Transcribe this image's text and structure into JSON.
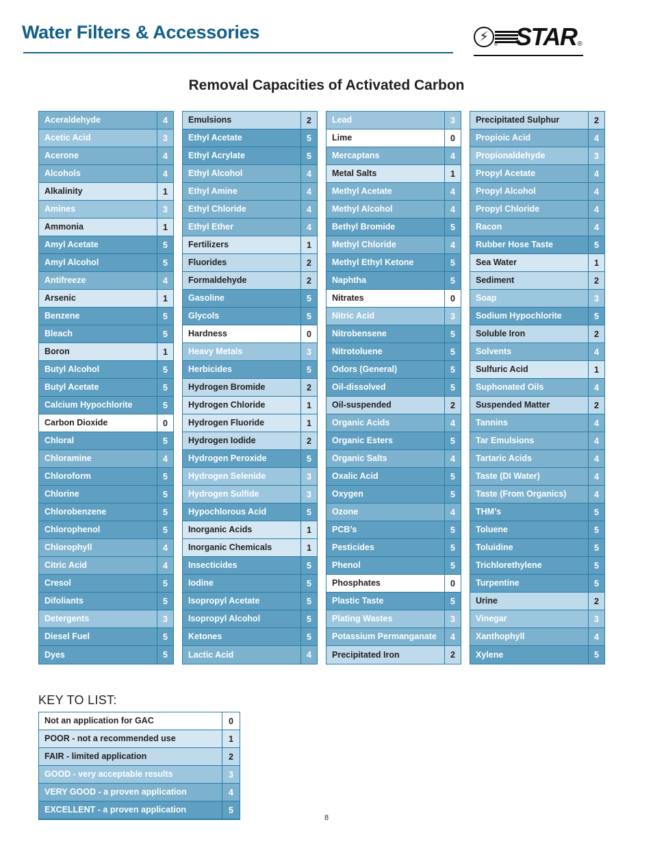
{
  "header": {
    "title": "Water Filters & Accessories",
    "logo": {
      "wordmark": "STAR",
      "registered": "®",
      "mark_glyph": "⚡"
    }
  },
  "section": {
    "title": "Removal Capacities of Activated Carbon"
  },
  "colors": {
    "brand_blue": "#115f88",
    "table_border": "#2a7ba6",
    "scale_0": "#ffffff",
    "scale_1": "#d4e7f2",
    "scale_2": "#bfdaea",
    "scale_3": "#9cc6de",
    "scale_4": "#7db2ce",
    "scale_5": "#5fa0c2"
  },
  "columns": [
    {
      "rows": [
        {
          "name": "Aceraldehyde",
          "value": "4"
        },
        {
          "name": "Acetic Acid",
          "value": "3"
        },
        {
          "name": "Acerone",
          "value": "4"
        },
        {
          "name": "Alcohols",
          "value": "4"
        },
        {
          "name": "Alkalinity",
          "value": "1"
        },
        {
          "name": "Amines",
          "value": "3"
        },
        {
          "name": "Ammonia",
          "value": "1"
        },
        {
          "name": "Amyl Acetate",
          "value": "5"
        },
        {
          "name": "Amyl Alcohol",
          "value": "5"
        },
        {
          "name": "Antifreeze",
          "value": "4"
        },
        {
          "name": "Arsenic",
          "value": "1"
        },
        {
          "name": "Benzene",
          "value": "5"
        },
        {
          "name": "Bleach",
          "value": "5"
        },
        {
          "name": "Boron",
          "value": "1"
        },
        {
          "name": "Butyl Alcohol",
          "value": "5"
        },
        {
          "name": "Butyl Acetate",
          "value": "5"
        },
        {
          "name": "Calcium Hypochlorite",
          "value": "5"
        },
        {
          "name": "Carbon Dioxide",
          "value": "0"
        },
        {
          "name": "Chloral",
          "value": "5"
        },
        {
          "name": "Chloramine",
          "value": "4"
        },
        {
          "name": "Chloroform",
          "value": "5"
        },
        {
          "name": "Chlorine",
          "value": "5"
        },
        {
          "name": "Chlorobenzene",
          "value": "5"
        },
        {
          "name": "Chlorophenol",
          "value": "5"
        },
        {
          "name": "Chlorophyll",
          "value": "4"
        },
        {
          "name": "Citric Acid",
          "value": "4"
        },
        {
          "name": "Cresol",
          "value": "5"
        },
        {
          "name": "Difoliants",
          "value": "5"
        },
        {
          "name": "Detergents",
          "value": "3"
        },
        {
          "name": "Diesel Fuel",
          "value": "5"
        },
        {
          "name": "Dyes",
          "value": "5"
        }
      ]
    },
    {
      "rows": [
        {
          "name": "Emulsions",
          "value": "2"
        },
        {
          "name": "Ethyl Acetate",
          "value": "5"
        },
        {
          "name": "Ethyl Acrylate",
          "value": "5"
        },
        {
          "name": "Ethyl Alcohol",
          "value": "4"
        },
        {
          "name": "Ethyl Amine",
          "value": "4"
        },
        {
          "name": "Ethyl Chloride",
          "value": "4"
        },
        {
          "name": "Ethyl Ether",
          "value": "4"
        },
        {
          "name": "Fertilizers",
          "value": "1"
        },
        {
          "name": "Fluorides",
          "value": "2"
        },
        {
          "name": "Formaldehyde",
          "value": "2"
        },
        {
          "name": "Gasoline",
          "value": "5"
        },
        {
          "name": "Glycols",
          "value": "5"
        },
        {
          "name": "Hardness",
          "value": "0"
        },
        {
          "name": "Heavy Metals",
          "value": "3"
        },
        {
          "name": "Herbicides",
          "value": "5"
        },
        {
          "name": "Hydrogen Bromide",
          "value": "2"
        },
        {
          "name": "Hydrogen Chloride",
          "value": "1"
        },
        {
          "name": "Hydrogen Fluoride",
          "value": "1"
        },
        {
          "name": "Hydrogen Iodide",
          "value": "2"
        },
        {
          "name": "Hydrogen Peroxide",
          "value": "5"
        },
        {
          "name": "Hydrogen Selenide",
          "value": "3"
        },
        {
          "name": "Hydrogen Sulfide",
          "value": "3"
        },
        {
          "name": "Hypochlorous Acid",
          "value": "5"
        },
        {
          "name": "Inorganic Acids",
          "value": "1"
        },
        {
          "name": "Inorganic Chemicals",
          "value": "1"
        },
        {
          "name": "Insecticides",
          "value": "5"
        },
        {
          "name": "Iodine",
          "value": "5"
        },
        {
          "name": "Isopropyl Acetate",
          "value": "5"
        },
        {
          "name": "Isopropyl Alcohol",
          "value": "5"
        },
        {
          "name": "Ketones",
          "value": "5"
        },
        {
          "name": "Lactic Acid",
          "value": "4"
        }
      ]
    },
    {
      "rows": [
        {
          "name": "Lead",
          "value": "3"
        },
        {
          "name": "Lime",
          "value": "0"
        },
        {
          "name": "Mercaptans",
          "value": "4"
        },
        {
          "name": "Metal Salts",
          "value": "1"
        },
        {
          "name": "Methyl Acetate",
          "value": "4"
        },
        {
          "name": "Methyl Alcohol",
          "value": "4"
        },
        {
          "name": "Bethyl Bromide",
          "value": "5"
        },
        {
          "name": "Methyl Chloride",
          "value": "4"
        },
        {
          "name": "Methyl Ethyl Ketone",
          "value": "5"
        },
        {
          "name": "Naphtha",
          "value": "5"
        },
        {
          "name": "Nitrates",
          "value": "0"
        },
        {
          "name": "Nitric Acid",
          "value": "3"
        },
        {
          "name": "Nitrobensene",
          "value": "5"
        },
        {
          "name": "Nitrotoluene",
          "value": "5"
        },
        {
          "name": "Odors (General)",
          "value": "5"
        },
        {
          "name": "Oil-dissolved",
          "value": "5"
        },
        {
          "name": "Oil-suspended",
          "value": "2"
        },
        {
          "name": "Organic Acids",
          "value": "4"
        },
        {
          "name": "Organic Esters",
          "value": "5"
        },
        {
          "name": "Organic Salts",
          "value": "4"
        },
        {
          "name": "Oxalic Acid",
          "value": "5"
        },
        {
          "name": "Oxygen",
          "value": "5"
        },
        {
          "name": "Ozone",
          "value": "4"
        },
        {
          "name": "PCB’s",
          "value": "5"
        },
        {
          "name": "Pesticides",
          "value": "5"
        },
        {
          "name": "Phenol",
          "value": "5"
        },
        {
          "name": "Phosphates",
          "value": "0"
        },
        {
          "name": "Plastic Taste",
          "value": "5"
        },
        {
          "name": "Plating Wastes",
          "value": "3"
        },
        {
          "name": "Potassium Permanganate",
          "value": "4"
        },
        {
          "name": "Precipitated Iron",
          "value": "2"
        }
      ]
    },
    {
      "rows": [
        {
          "name": "Precipitated Sulphur",
          "value": "2"
        },
        {
          "name": "Propioic Acid",
          "value": "4"
        },
        {
          "name": "Propionaldehyde",
          "value": "3"
        },
        {
          "name": "Propyl Acetate",
          "value": "4"
        },
        {
          "name": "Propyl Alcohol",
          "value": "4"
        },
        {
          "name": "Propyl Chloride",
          "value": "4"
        },
        {
          "name": "Racon",
          "value": "4"
        },
        {
          "name": "Rubber Hose Taste",
          "value": "5"
        },
        {
          "name": "Sea Water",
          "value": "1"
        },
        {
          "name": "Sediment",
          "value": "2"
        },
        {
          "name": "Soap",
          "value": "3"
        },
        {
          "name": "Sodium Hypochlorite",
          "value": "5"
        },
        {
          "name": "Soluble Iron",
          "value": "2"
        },
        {
          "name": "Solvents",
          "value": "4"
        },
        {
          "name": "Sulfuric Acid",
          "value": "1"
        },
        {
          "name": "Suphonated Oils",
          "value": "4"
        },
        {
          "name": "Suspended Matter",
          "value": "2"
        },
        {
          "name": "Tannins",
          "value": "4"
        },
        {
          "name": "Tar Emulsions",
          "value": "4"
        },
        {
          "name": "Tartaric Acids",
          "value": "4"
        },
        {
          "name": "Taste (DI Water)",
          "value": "4"
        },
        {
          "name": "Taste (From Organics)",
          "value": "4"
        },
        {
          "name": "THM’s",
          "value": "5"
        },
        {
          "name": "Toluene",
          "value": "5"
        },
        {
          "name": "Toluidine",
          "value": "5"
        },
        {
          "name": "Trichlorethylene",
          "value": "5"
        },
        {
          "name": "Turpentine",
          "value": "5"
        },
        {
          "name": "Urine",
          "value": "2"
        },
        {
          "name": "Vinegar",
          "value": "3"
        },
        {
          "name": "Xanthophyll",
          "value": "4"
        },
        {
          "name": "Xylene",
          "value": "5"
        }
      ]
    }
  ],
  "key": {
    "heading": "KEY TO LIST:",
    "rows": [
      {
        "name": "Not an application for GAC",
        "value": "0"
      },
      {
        "name": "POOR - not a recommended use",
        "value": "1"
      },
      {
        "name": "FAIR - limited application",
        "value": "2"
      },
      {
        "name": "GOOD - very acceptable results",
        "value": "3"
      },
      {
        "name": "VERY GOOD - a proven application",
        "value": "4"
      },
      {
        "name": "EXCELLENT - a proven application",
        "value": "5"
      }
    ]
  },
  "footer": {
    "page_number": "8"
  }
}
